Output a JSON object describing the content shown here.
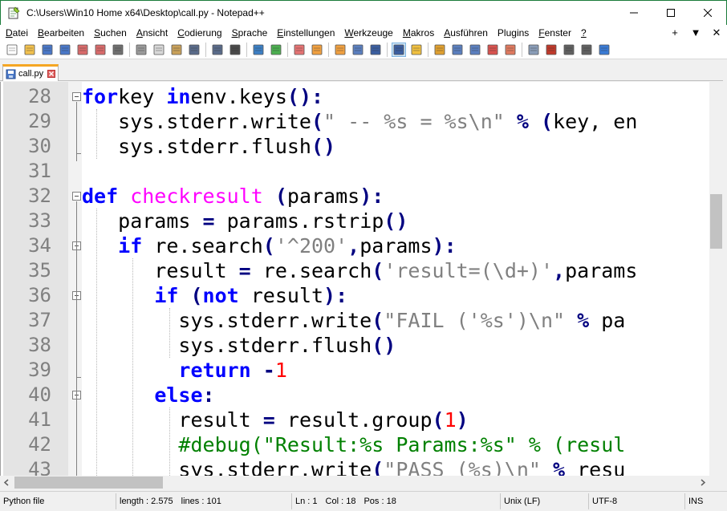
{
  "window": {
    "title": "C:\\Users\\Win10 Home x64\\Desktop\\call.py - Notepad++"
  },
  "menu": {
    "items": [
      {
        "u": "D",
        "rest": "atei"
      },
      {
        "u": "B",
        "rest": "earbeiten"
      },
      {
        "u": "S",
        "rest": "uchen"
      },
      {
        "u": "A",
        "rest": "nsicht"
      },
      {
        "u": "C",
        "rest": "odierung"
      },
      {
        "u": "S",
        "rest": "prache"
      },
      {
        "u": "E",
        "rest": "instellungen"
      },
      {
        "u": "W",
        "rest": "erkzeuge"
      },
      {
        "u": "M",
        "rest": "akros"
      },
      {
        "u": "A",
        "rest": "usführen"
      },
      {
        "u": "",
        "rest": "Plugins"
      },
      {
        "u": "F",
        "rest": "enster"
      },
      {
        "u": "?",
        "rest": ""
      }
    ],
    "right": [
      "+",
      "▼",
      "✕"
    ]
  },
  "tab": {
    "label": "call.py"
  },
  "editor": {
    "lines": [
      {
        "n": "28",
        "tokens": [
          [
            "kw",
            "for"
          ],
          [
            "",
            "key "
          ],
          [
            "kw",
            "in"
          ],
          [
            "",
            "env.keys"
          ],
          [
            "op",
            "():"
          ]
        ]
      },
      {
        "n": "29",
        "tokens": [
          [
            "",
            "   sys.stderr.write"
          ],
          [
            "op",
            "("
          ],
          [
            "str",
            "\" -- %s = %s\\n\""
          ],
          [
            "",
            ""
          ],
          [
            "op",
            " % ("
          ],
          [
            "",
            "key, en"
          ]
        ]
      },
      {
        "n": "30",
        "tokens": [
          [
            "",
            "   sys.stderr.flush"
          ],
          [
            "op",
            "()"
          ]
        ]
      },
      {
        "n": "31",
        "tokens": []
      },
      {
        "n": "32",
        "tokens": [
          [
            "kw",
            "def"
          ],
          [
            "",
            ""
          ],
          [
            "fn",
            " checkresult"
          ],
          [
            "op",
            " ("
          ],
          [
            "",
            "params"
          ],
          [
            "op",
            "):"
          ]
        ]
      },
      {
        "n": "33",
        "tokens": [
          [
            "",
            "   params "
          ],
          [
            "op",
            "="
          ],
          [
            "",
            ""
          ],
          [
            "",
            ""
          ],
          [
            "",
            ""
          ],
          [
            "",
            ""
          ],
          [
            "",
            " params.rstrip"
          ],
          [
            "op",
            "()"
          ]
        ]
      },
      {
        "n": "34",
        "tokens": [
          [
            "",
            "   "
          ],
          [
            "kw",
            "if"
          ],
          [
            "",
            " re.search"
          ],
          [
            "op",
            "("
          ],
          [
            "str",
            "'^200'"
          ],
          [
            "op",
            ","
          ],
          [
            "",
            "params"
          ],
          [
            "op",
            "):"
          ]
        ]
      },
      {
        "n": "35",
        "tokens": [
          [
            "",
            "      result "
          ],
          [
            "op",
            "="
          ],
          [
            "",
            " re.search"
          ],
          [
            "op",
            "("
          ],
          [
            "str",
            "'result=(\\d+)'"
          ],
          [
            "op",
            ","
          ],
          [
            "",
            "params"
          ]
        ]
      },
      {
        "n": "36",
        "tokens": [
          [
            "",
            "      "
          ],
          [
            "kw",
            "if"
          ],
          [
            "op",
            " ("
          ],
          [
            "kw",
            "not"
          ],
          [
            "",
            " result"
          ],
          [
            "op",
            "):"
          ]
        ]
      },
      {
        "n": "37",
        "tokens": [
          [
            "",
            "        sys.stderr.write"
          ],
          [
            "op",
            "("
          ],
          [
            "str",
            "\"FAIL ('%s')\\n\""
          ],
          [
            "op",
            " % "
          ],
          [
            "",
            "pa"
          ]
        ]
      },
      {
        "n": "38",
        "tokens": [
          [
            "",
            "        sys.stderr.flush"
          ],
          [
            "op",
            "()"
          ]
        ]
      },
      {
        "n": "39",
        "tokens": [
          [
            "",
            "        "
          ],
          [
            "kw",
            "return"
          ],
          [
            "op",
            " -"
          ],
          [
            "num",
            "1"
          ]
        ]
      },
      {
        "n": "40",
        "tokens": [
          [
            "",
            "      "
          ],
          [
            "kw",
            "else"
          ],
          [
            "op",
            ":"
          ]
        ]
      },
      {
        "n": "41",
        "tokens": [
          [
            "",
            "        result "
          ],
          [
            "op",
            "="
          ],
          [
            "",
            " result.group"
          ],
          [
            "op",
            "("
          ],
          [
            "num",
            "1"
          ],
          [
            "op",
            ")"
          ]
        ]
      },
      {
        "n": "42",
        "tokens": [
          [
            "",
            "        "
          ],
          [
            "cm",
            "#debug(\"Result:%s Params:%s\" % (resul"
          ]
        ]
      },
      {
        "n": "43",
        "tokens": [
          [
            "",
            "        sys.stderr.write"
          ],
          [
            "op",
            "("
          ],
          [
            "str",
            "\"PASS (%s)\\n\""
          ],
          [
            "op",
            " % "
          ],
          [
            "",
            "resu"
          ]
        ]
      }
    ]
  },
  "status": {
    "filetype": "Python file",
    "length": "length : 2.575",
    "lines": "lines : 101",
    "ln": "Ln : 1",
    "col": "Col : 18",
    "pos": "Pos : 18",
    "eol": "Unix (LF)",
    "encoding": "UTF-8",
    "mode": "INS"
  },
  "colors": {
    "keyword": "#0000ff",
    "operator": "#000080",
    "string": "#808080",
    "function": "#ff00ff",
    "number": "#ff0000",
    "comment": "#008000",
    "tab_accent": "#f5a623",
    "window_border": "#1a7c3a"
  },
  "toolbar_icons": [
    "new-file-icon",
    "open-file-icon",
    "save-icon",
    "save-all-icon",
    "close-icon",
    "close-all-icon",
    "print-icon",
    "cut-icon",
    "copy-icon",
    "paste-icon",
    "undo-icon",
    "redo-icon",
    "find-icon",
    "replace-icon",
    "zoom-in-icon",
    "zoom-out-icon",
    "sync-v-icon",
    "sync-h-icon",
    "word-wrap-icon",
    "show-all-chars-icon",
    "indent-guide-icon",
    "user-lang-icon",
    "doc-map-icon",
    "doc-list-icon",
    "function-list-icon",
    "folder-workspace-icon",
    "monitor-icon",
    "record-macro-icon",
    "stop-macro-icon",
    "play-macro-icon",
    "run-macro-multiple-icon",
    "save-macro-icon"
  ]
}
